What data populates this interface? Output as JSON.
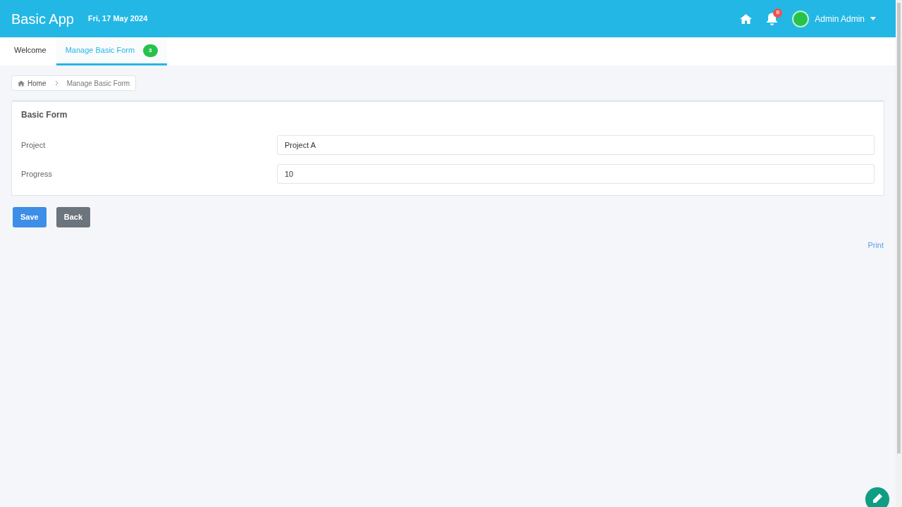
{
  "app": {
    "title": "Basic App",
    "date": "Fri, 17 May 2024"
  },
  "header": {
    "notification_count": "0",
    "user": "Admin Admin"
  },
  "tabs": [
    {
      "label": "Welcome",
      "selected": false
    },
    {
      "label": "Manage Basic Form",
      "selected": true,
      "badge": "3"
    }
  ],
  "breadcrumb": [
    "Home",
    "Manage Basic Form"
  ],
  "form": {
    "title": "Basic Form",
    "fields": [
      {
        "label": "Project",
        "value": "Project A"
      },
      {
        "label": "Progress",
        "value": "10"
      }
    ]
  },
  "buttons": [
    {
      "label": "Save",
      "kind": "primary"
    },
    {
      "label": "Back",
      "kind": "secondary"
    }
  ],
  "print_link": "Print"
}
